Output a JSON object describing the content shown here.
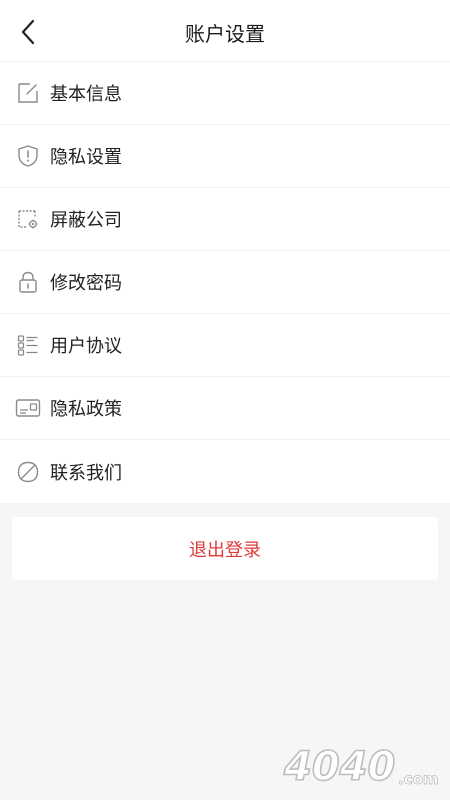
{
  "header": {
    "title": "账户设置",
    "back_icon": "chevron-left-icon"
  },
  "menu": [
    {
      "label": "基本信息",
      "icon": "edit-icon"
    },
    {
      "label": "隐私设置",
      "icon": "shield-alert-icon"
    },
    {
      "label": "屏蔽公司",
      "icon": "block-company-icon"
    },
    {
      "label": "修改密码",
      "icon": "lock-icon"
    },
    {
      "label": "用户协议",
      "icon": "list-icon"
    },
    {
      "label": "隐私政策",
      "icon": "card-icon"
    },
    {
      "label": "联系我们",
      "icon": "leaf-icon"
    }
  ],
  "logout": {
    "label": "退出登录"
  },
  "watermark": {
    "text": "4040",
    "suffix": ".com"
  },
  "colors": {
    "background": "#f6f6f8",
    "logout_text": "#e03a3a",
    "icon_stroke": "#8a8a8a"
  }
}
